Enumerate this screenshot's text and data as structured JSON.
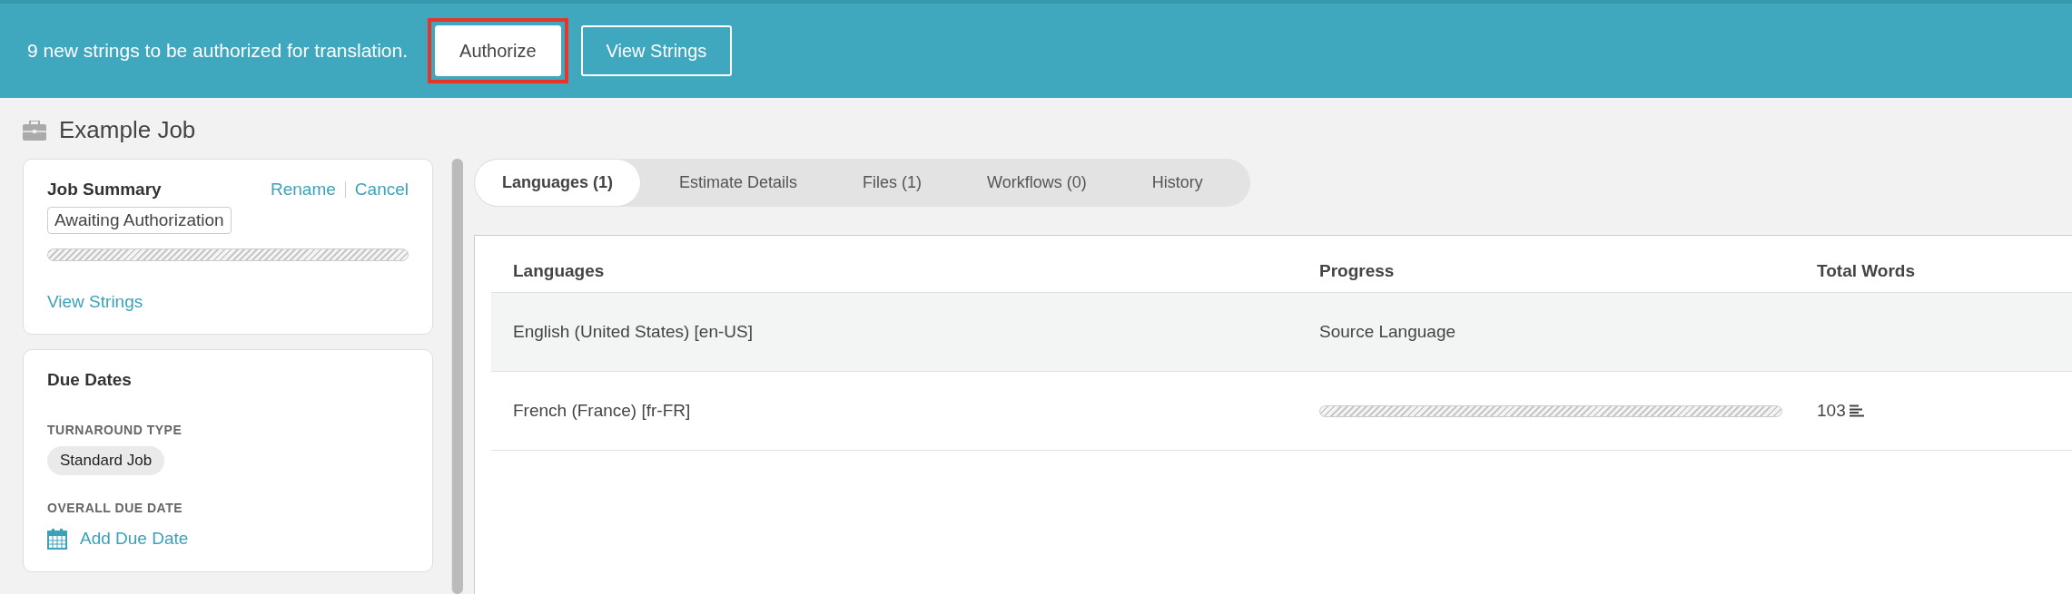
{
  "banner": {
    "message": "9 new strings to be authorized for translation.",
    "buttons": [
      {
        "label": "Authorize",
        "kind": "primary",
        "highlighted": true
      },
      {
        "label": "View Strings",
        "kind": "outline",
        "highlighted": false
      }
    ]
  },
  "job": {
    "title": "Example Job"
  },
  "summary": {
    "heading": "Job Summary",
    "actions": [
      "Rename",
      "Cancel"
    ],
    "status": "Awaiting Authorization",
    "link": "View Strings",
    "level": 0
  },
  "due_dates": {
    "heading": "Due Dates",
    "turnaround_label": "TURNAROUND TYPE",
    "turnaround": "Standard Job",
    "due_label": "OVERALL DUE DATE",
    "due_link": "Add Due Date"
  },
  "tabs": [
    {
      "label": "Languages (1)",
      "selected": true
    },
    {
      "label": "Estimate Details",
      "selected": false
    },
    {
      "label": "Files (1)",
      "selected": false
    },
    {
      "label": "Workflows (0)",
      "selected": false
    },
    {
      "label": "History",
      "selected": false
    }
  ],
  "table": {
    "columns": [
      "Languages",
      "Progress",
      "Total Words"
    ],
    "rows": [
      {
        "language": "English (United States) [en-US]",
        "kind": "source",
        "progress": "Source Language",
        "shaded": true
      },
      {
        "language": "French (France) [fr-FR]",
        "kind": "target",
        "level": 0,
        "words": "103",
        "shaded": false
      }
    ]
  }
}
